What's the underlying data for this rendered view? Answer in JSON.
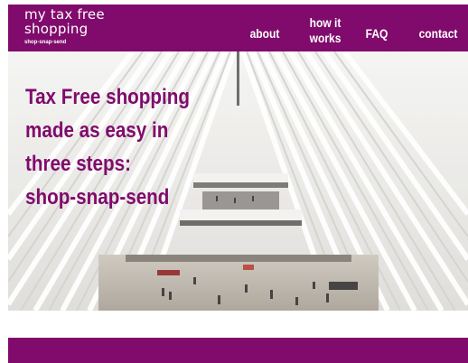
{
  "brand": {
    "name": "my tax free\nshopping",
    "tagline": "shop-snap-send"
  },
  "nav": {
    "about": "about",
    "how_it_works": "how it\nworks",
    "faq": "FAQ",
    "contact": "contact"
  },
  "hero": {
    "headline": "Tax Free shopping\nmade as easy in\nthree steps:\nshop-snap-send"
  },
  "colors": {
    "brand": "#800b6c",
    "hero_bg": "#ecebe8"
  }
}
